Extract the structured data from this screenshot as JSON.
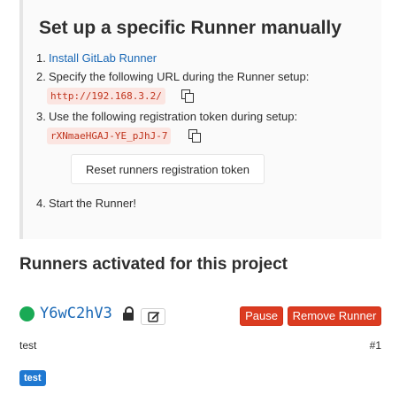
{
  "setup": {
    "title": "Set up a specific Runner manually",
    "steps": {
      "s1_num": "1.",
      "s1_link": "Install GitLab Runner",
      "s2_num": "2.",
      "s2_text": "Specify the following URL during the Runner setup:",
      "url": "http://192.168.3.2/",
      "s3_num": "3.",
      "s3_text": "Use the following registration token during setup:",
      "token": "rXNmaeHGAJ-YE_pJhJ-7",
      "reset_label": "Reset runners registration token",
      "s4_num": "4.",
      "s4_text": "Start the Runner!"
    },
    "icons": {
      "copy": "copy-icon"
    }
  },
  "runners": {
    "title": "Runners activated for this project",
    "items": [
      {
        "status_color": "#1aaa55",
        "name": "Y6wC2hV3",
        "locked_icon": "lock-icon",
        "edit_icon": "edit-icon",
        "pause_label": "Pause",
        "remove_label": "Remove Runner",
        "description": "test",
        "id": "#1",
        "tags": [
          "test"
        ]
      }
    ]
  },
  "colors": {
    "link": "#1b69b6",
    "danger": "#db3b21",
    "success": "#1aaa55",
    "tag": "#1f78d1"
  }
}
